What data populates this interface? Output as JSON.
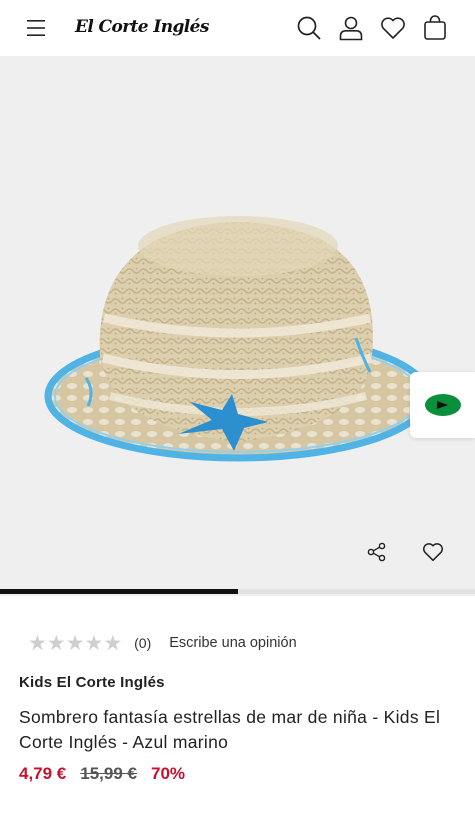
{
  "header": {
    "logo_text": "El Corte Inglés",
    "icons": [
      "menu-icon",
      "search-icon",
      "user-icon",
      "heart-icon",
      "bag-icon"
    ]
  },
  "gallery": {
    "image_position": {
      "current": 1,
      "total": 2
    },
    "actions": [
      "share-icon",
      "heart-outline-icon"
    ],
    "promo_badge_color": "#0a8f3c"
  },
  "rating": {
    "stars": 0,
    "count": "(0)",
    "write_review": "Escribe una opinión"
  },
  "product": {
    "brand": "Kids El Corte Inglés",
    "title": "Sombrero fantasía estrellas de mar de niña - Kids El Corte Inglés - Azul marino",
    "price_now": "4,79 €",
    "price_old": "15,99 €",
    "discount": "70%"
  },
  "colors": {
    "sale_red": "#c8102e",
    "straw": "#d9c9a3",
    "trim_blue": "#4fb3e6",
    "star_blue": "#2b8fd0"
  }
}
